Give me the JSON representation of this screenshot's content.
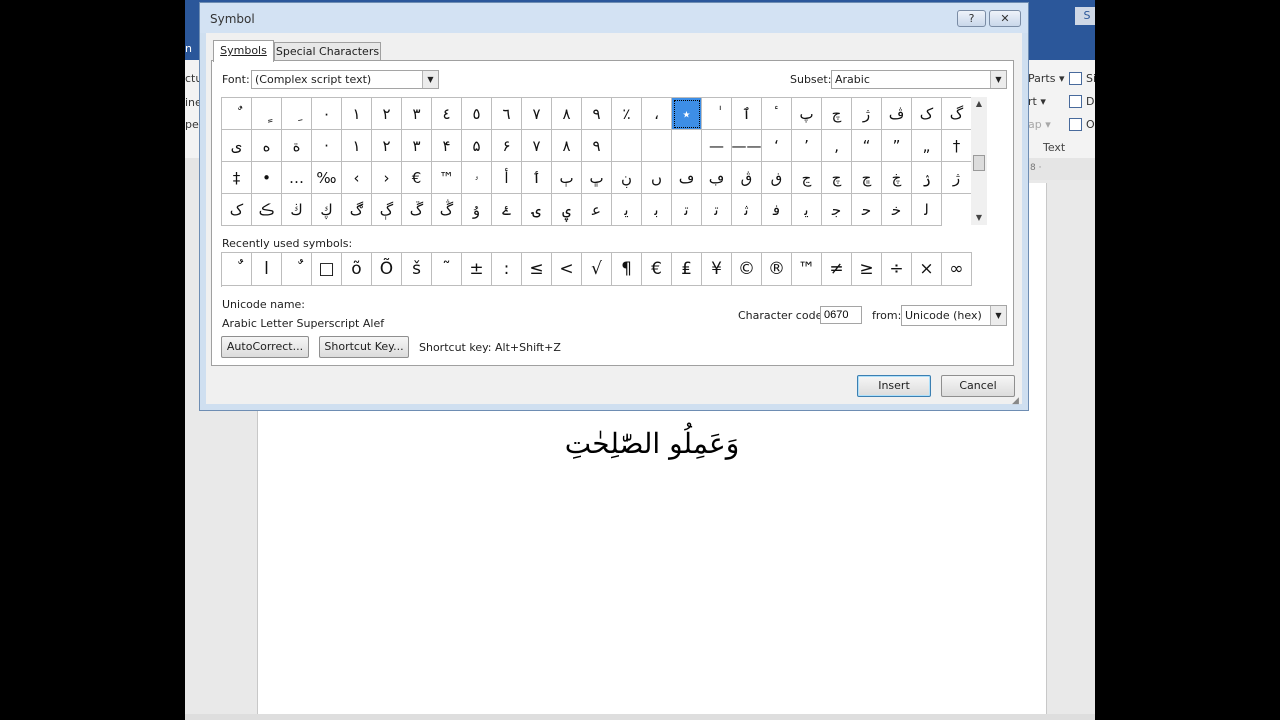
{
  "word": {
    "tab_fragment": "n",
    "title_button": "S",
    "ribbon_items": [
      {
        "text": "ctur"
      },
      {
        "text": "ine"
      },
      {
        "text": "pe"
      },
      {
        "text": "Parts ▾"
      },
      {
        "text": "rt ▾"
      },
      {
        "text": "ap ▾"
      },
      {
        "text": "Si"
      },
      {
        "text": "D"
      },
      {
        "text": "O"
      }
    ],
    "group_label": "Text",
    "ruler_mark": "8 ·",
    "document_text": "وَعَمِلُو الصّٰلِحٰتِ"
  },
  "dialog": {
    "title": "Symbol",
    "help_label": "?",
    "close_label": "✕",
    "tabs": [
      "Symbols",
      "Special Characters"
    ],
    "font": {
      "label": "Font:",
      "value": "(Complex script text)"
    },
    "subset": {
      "label": "Subset:",
      "value": "Arabic"
    },
    "symbols": [
      "ٌ",
      "ٍ",
      "ِ",
      "٠",
      "١",
      "٢",
      "٣",
      "٤",
      "٥",
      "٦",
      "٧",
      "٨",
      "٩",
      "٪",
      "،",
      "٭",
      "ٰ",
      "ٱ",
      "ٴ",
      "پ",
      "چ",
      "ژ",
      "ڤ",
      "ک",
      "گ",
      "ی",
      "ه",
      "ة",
      "·",
      "١",
      "٢",
      "٣",
      "۴",
      "۵",
      "۶",
      "٧",
      "٨",
      "٩",
      "",
      "",
      "",
      "—",
      "——",
      "‘",
      "’",
      "‚",
      "“",
      "”",
      "„",
      "†",
      "‡",
      "•",
      "…",
      "‰",
      "‹",
      "›",
      "€",
      "™",
      "ۥ",
      "أ",
      "ٲ",
      "ٻ",
      "ڀ",
      "ڹ",
      "ں",
      "ڡ",
      "ڢ",
      "ڨ",
      "ڧ",
      "ڃ",
      "چ",
      "ڇ",
      "ڿ",
      "ۯ",
      "ژ",
      "ک",
      "ڪ",
      "ڬ",
      "ڮ",
      "ڰ",
      "ڳ",
      "ڱ",
      "ڴ",
      "ۇ",
      "ۓ",
      "ۍ",
      "ۑ",
      "ﻋ",
      "ﻳ",
      "ﺑ",
      "ﺗ",
      "ﺗ",
      "ﺛ",
      "ﻓ",
      "ﻳ",
      "ﺟ",
      "ﺣ",
      "ﺧ",
      "ﻟ"
    ],
    "selected_index": 15,
    "recent_label": "Recently used symbols:",
    "recent_symbols": [
      "ٌ",
      "ا",
      "ٌ",
      "□",
      "õ",
      "Õ",
      "š",
      "˜",
      "±",
      ":",
      "≤",
      "<",
      "√",
      "¶",
      "€",
      "₤",
      "¥",
      "©",
      "®",
      "™",
      "≠",
      "≥",
      "÷",
      "×",
      "∞"
    ],
    "unicode_name_label": "Unicode name:",
    "unicode_name": "Arabic Letter Superscript Alef",
    "char_code_label": "Character code:",
    "char_code": "0670",
    "from_label": "from:",
    "from_value": "Unicode (hex)",
    "autocorrect_label": "AutoCorrect...",
    "shortcut_key_button": "Shortcut Key...",
    "shortcut_text": "Shortcut key: Alt+Shift+Z",
    "insert_label": "Insert",
    "cancel_label": "Cancel"
  }
}
